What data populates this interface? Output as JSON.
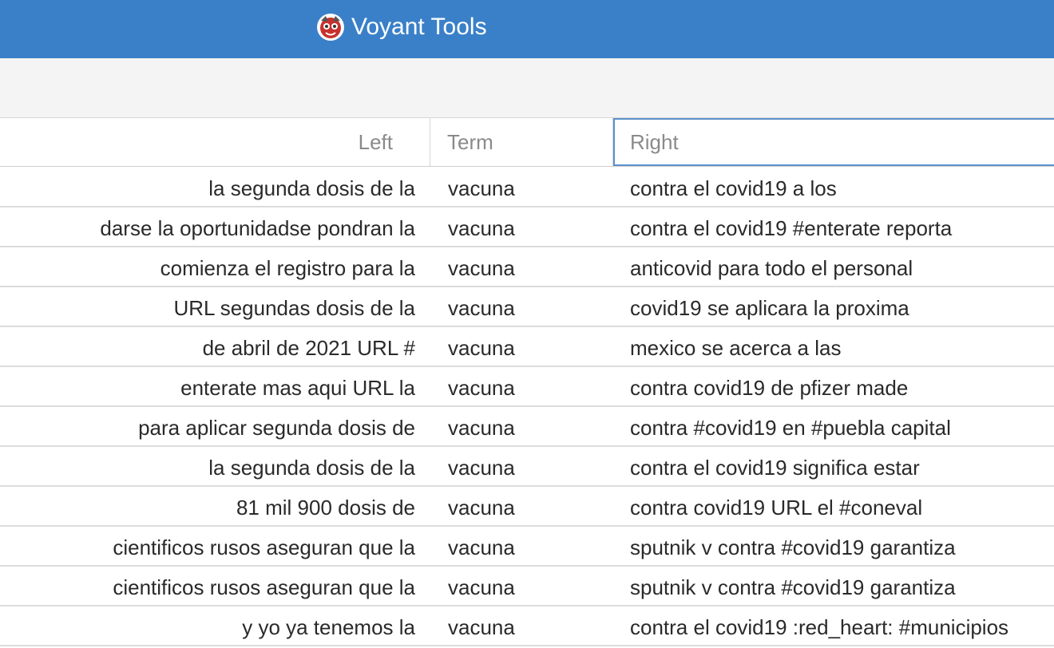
{
  "app": {
    "title": "Voyant Tools"
  },
  "colors": {
    "header_bg": "#3a80c8",
    "toolbar_bg": "#f4f4f4",
    "active_column_border": "#5b92cc"
  },
  "grid": {
    "columns": {
      "left": "Left",
      "term": "Term",
      "right": "Right"
    },
    "rows": [
      {
        "left": "la segunda dosis de la",
        "term": "vacuna",
        "right": "contra el covid19 a los"
      },
      {
        "left": "darse la oportunidadse pondran la",
        "term": "vacuna",
        "right": "contra el covid19 #enterate reporta"
      },
      {
        "left": "comienza el registro para la",
        "term": "vacuna",
        "right": "anticovid para todo el personal"
      },
      {
        "left": "URL segundas dosis de la",
        "term": "vacuna",
        "right": "covid19 se aplicara la proxima"
      },
      {
        "left": "de abril de 2021 URL #",
        "term": "vacuna",
        "right": "mexico se acerca a las"
      },
      {
        "left": "enterate mas aqui URL la",
        "term": "vacuna",
        "right": "contra covid19 de pfizer made"
      },
      {
        "left": "para aplicar segunda dosis de",
        "term": "vacuna",
        "right": "contra #covid19 en #puebla capital"
      },
      {
        "left": "la segunda dosis de la",
        "term": "vacuna",
        "right": "contra el covid19 significa estar"
      },
      {
        "left": "81 mil 900 dosis de",
        "term": "vacuna",
        "right": "contra covid19 URL el #coneval"
      },
      {
        "left": "cientificos rusos aseguran que la",
        "term": "vacuna",
        "right": "sputnik v contra #covid19 garantiza"
      },
      {
        "left": "cientificos rusos aseguran que la",
        "term": "vacuna",
        "right": "sputnik v contra #covid19 garantiza"
      },
      {
        "left": "y yo ya tenemos la",
        "term": "vacuna",
        "right": "contra el covid19 :red_heart: #municipios"
      }
    ]
  }
}
